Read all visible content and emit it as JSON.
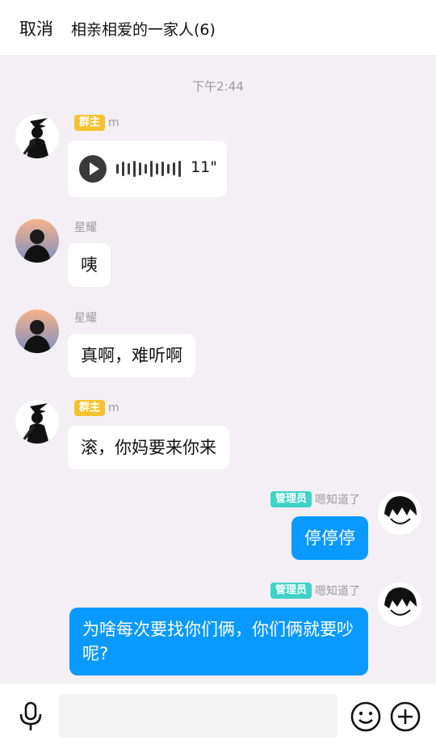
{
  "header": {
    "cancel_label": "取消",
    "title": "相亲相爱的一家人(6)"
  },
  "chat": {
    "timestamp": "下午2:44",
    "messages": [
      {
        "direction": "in",
        "sender": "m",
        "badge": "群主",
        "type": "voice",
        "duration": "11\""
      },
      {
        "direction": "in",
        "sender": "星耀",
        "badge": "",
        "type": "text",
        "text": "咦"
      },
      {
        "direction": "in",
        "sender": "星耀",
        "badge": "",
        "type": "text",
        "text": "真啊，难听啊"
      },
      {
        "direction": "in",
        "sender": "m",
        "badge": "群主",
        "type": "text",
        "text": "滚，你妈要来你来"
      },
      {
        "direction": "out",
        "sender": "嗯知道了",
        "badge": "管理员",
        "type": "text",
        "text": "停停停"
      },
      {
        "direction": "out",
        "sender": "嗯知道了",
        "badge": "管理员",
        "type": "text",
        "text": "为啥每次要找你们俩，你们俩就要吵呢?"
      }
    ]
  },
  "input": {
    "placeholder": "",
    "left_icon": "microphone-icon",
    "right_icons": [
      "emoji-icon",
      "add-icon"
    ]
  },
  "colors": {
    "background": "#f3eff4",
    "outgoing_bubble": "#0a99ff",
    "owner_badge": "#f6c330",
    "admin_badge": "#3fd3c6"
  }
}
